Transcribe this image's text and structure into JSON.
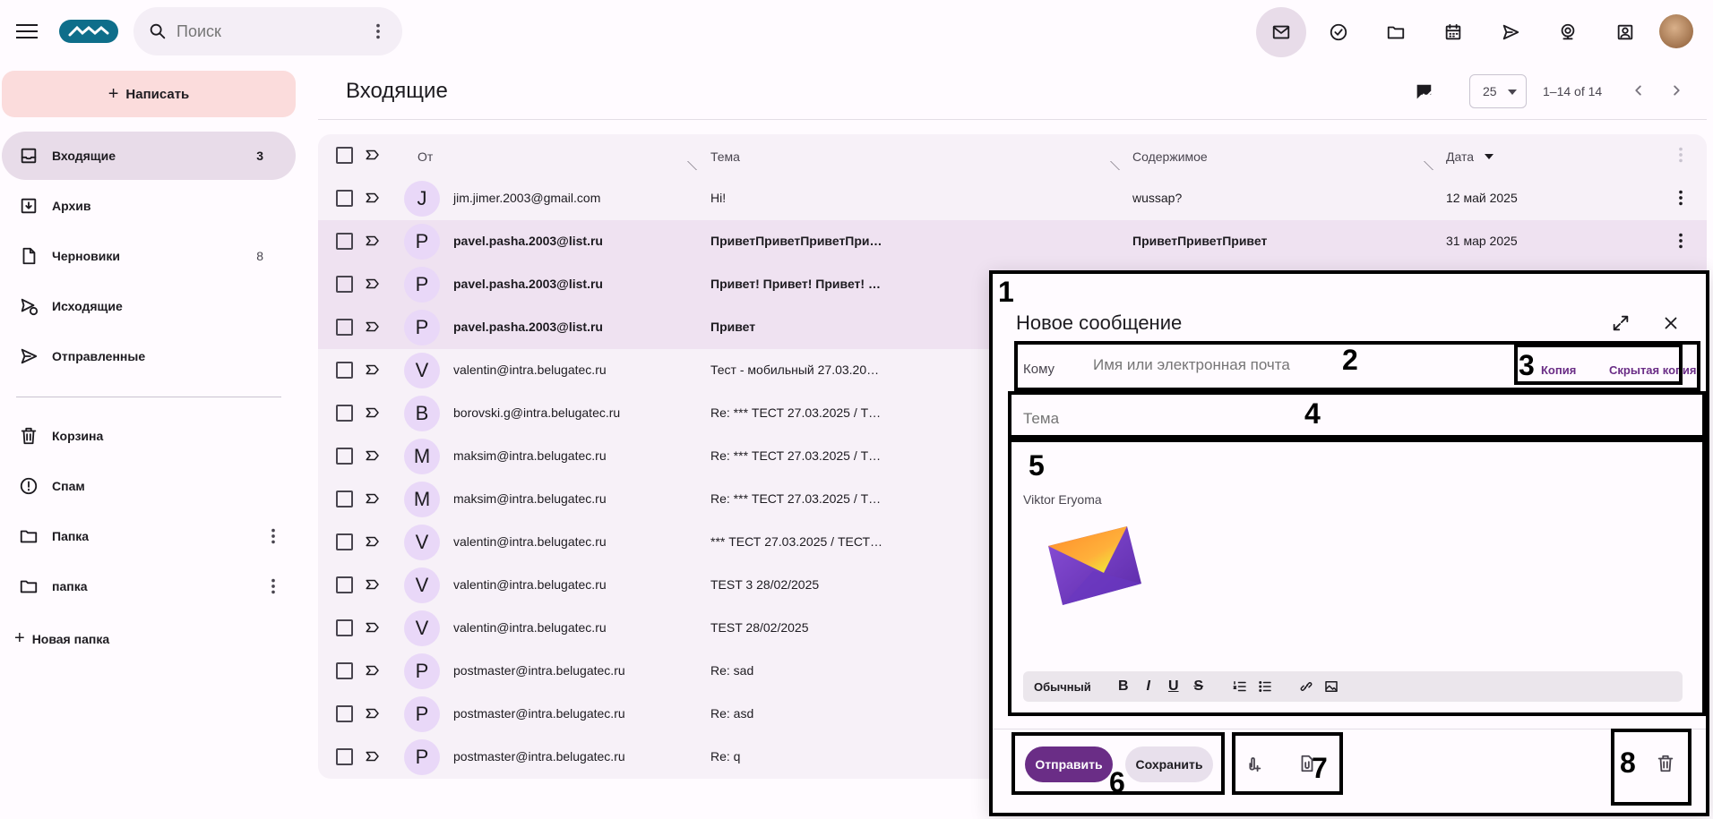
{
  "topbar": {
    "search_placeholder": "Поиск",
    "icons": [
      "mail-icon",
      "tasks-icon",
      "folder-icon",
      "calendar-icon",
      "send-icon",
      "webcam-icon",
      "contacts-icon"
    ]
  },
  "sidebar": {
    "compose_label": "Написать",
    "items": [
      {
        "label": "Входящие",
        "count": "3",
        "active": true
      },
      {
        "label": "Архив",
        "count": ""
      },
      {
        "label": "Черновики",
        "count": "8"
      },
      {
        "label": "Исходящие",
        "count": ""
      },
      {
        "label": "Отправленные",
        "count": ""
      },
      {
        "label": "Корзина",
        "count": ""
      },
      {
        "label": "Спам",
        "count": ""
      },
      {
        "label": "Папка",
        "count": ""
      },
      {
        "label": "папка",
        "count": ""
      }
    ],
    "new_folder_label": "Новая папка"
  },
  "main": {
    "title": "Входящие",
    "per_page": "25",
    "range": "1–14 of 14",
    "columns": {
      "from": "От",
      "subject": "Тема",
      "body": "Содержимое",
      "date": "Дата"
    },
    "rows": [
      {
        "avatar": "J",
        "from": "jim.jimer.2003@gmail.com",
        "subject": "Hi!",
        "body": "wussap?",
        "date": "12 май 2025",
        "unread": false
      },
      {
        "avatar": "P",
        "from": "pavel.pasha.2003@list.ru",
        "subject": "ПриветПриветПриветПри…",
        "body": "ПриветПриветПривет",
        "date": "31 мар 2025",
        "unread": true
      },
      {
        "avatar": "P",
        "from": "pavel.pasha.2003@list.ru",
        "subject": "Привет! Привет! Привет! …",
        "body": "",
        "date": "",
        "unread": true
      },
      {
        "avatar": "P",
        "from": "pavel.pasha.2003@list.ru",
        "subject": "Привет",
        "body": "",
        "date": "",
        "unread": true
      },
      {
        "avatar": "V",
        "from": "valentin@intra.belugatec.ru",
        "subject": "Тест - мобильный 27.03.20…",
        "body": "",
        "date": "",
        "unread": false
      },
      {
        "avatar": "B",
        "from": "borovski.g@intra.belugatec.ru",
        "subject": "Re: *** ТЕСТ 27.03.2025 / Т…",
        "body": "",
        "date": "",
        "unread": false
      },
      {
        "avatar": "M",
        "from": "maksim@intra.belugatec.ru",
        "subject": "Re: *** ТЕСТ 27.03.2025 / Т…",
        "body": "",
        "date": "",
        "unread": false
      },
      {
        "avatar": "M",
        "from": "maksim@intra.belugatec.ru",
        "subject": "Re: *** ТЕСТ 27.03.2025 / Т…",
        "body": "",
        "date": "",
        "unread": false
      },
      {
        "avatar": "V",
        "from": "valentin@intra.belugatec.ru",
        "subject": "*** ТЕСТ 27.03.2025 / ТЕСТ…",
        "body": "",
        "date": "",
        "unread": false
      },
      {
        "avatar": "V",
        "from": "valentin@intra.belugatec.ru",
        "subject": "TEST 3 28/02/2025",
        "body": "",
        "date": "",
        "unread": false
      },
      {
        "avatar": "V",
        "from": "valentin@intra.belugatec.ru",
        "subject": "TEST 28/02/2025",
        "body": "",
        "date": "",
        "unread": false
      },
      {
        "avatar": "P",
        "from": "postmaster@intra.belugatec.ru",
        "subject": "Re: sad",
        "body": "",
        "date": "",
        "unread": false
      },
      {
        "avatar": "P",
        "from": "postmaster@intra.belugatec.ru",
        "subject": "Re: asd",
        "body": "",
        "date": "",
        "unread": false
      },
      {
        "avatar": "P",
        "from": "postmaster@intra.belugatec.ru",
        "subject": "Re: q",
        "body": "",
        "date": "",
        "unread": false
      }
    ]
  },
  "compose": {
    "title": "Новое сообщение",
    "to_label": "Кому",
    "to_placeholder": "Имя или электронная почта",
    "cc_label": "Копия",
    "bcc_label": "Скрытая копия",
    "subject_placeholder": "Тема",
    "signature": "Viktor Eryoma",
    "format_style": "Обычный",
    "send_label": "Отправить",
    "save_label": "Сохранить",
    "markers": [
      "1",
      "2",
      "3",
      "4",
      "5",
      "6",
      "7",
      "8"
    ]
  },
  "colors": {
    "accent": "#6a2d86",
    "selected_nav": "#e8dce9",
    "compose_btn": "#fbdcdc",
    "unread_row": "#efe2f1"
  }
}
